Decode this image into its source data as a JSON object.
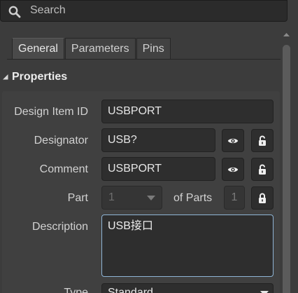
{
  "search": {
    "placeholder": "Search",
    "value": ""
  },
  "tabs": [
    {
      "label": "General",
      "active": true
    },
    {
      "label": "Parameters",
      "active": false
    },
    {
      "label": "Pins",
      "active": false
    }
  ],
  "section": {
    "title": "Properties",
    "expanded": true
  },
  "properties": {
    "design_item_id": {
      "label": "Design Item ID",
      "value": "USBPORT"
    },
    "designator": {
      "label": "Designator",
      "value": "USB?"
    },
    "comment": {
      "label": "Comment",
      "value": "USBPORT"
    },
    "part": {
      "label": "Part",
      "value": "1",
      "of_parts_label": "of Parts",
      "parts_count": "1"
    },
    "description": {
      "label": "Description",
      "value": "USB接口"
    },
    "type": {
      "label": "Type",
      "value": "Standard"
    }
  },
  "icons": {
    "search": "search-icon",
    "visibility": "eye-icon",
    "lock": "lock-icon",
    "unlock": "unlock-icon",
    "dropdown": "chevron-down-icon",
    "collapse": "triangle-down-icon",
    "scroll_up": "chevron-up-icon"
  },
  "colors": {
    "panel_bg": "#404040",
    "window_bg": "#3c3c3c",
    "field_bg": "#2e2e2e",
    "focus_border": "#8fb5d6",
    "text": "#d6d6d6"
  }
}
